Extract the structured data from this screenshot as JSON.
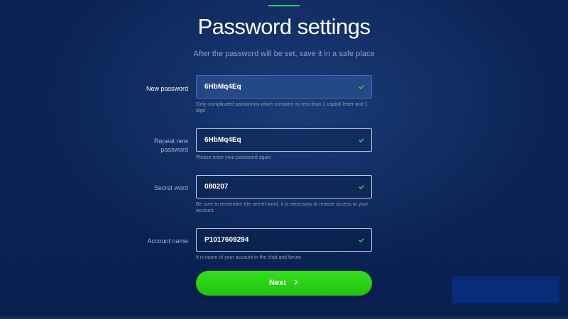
{
  "page": {
    "title": "Password settings",
    "subtitle": "After the password will be set, save it in a safe place"
  },
  "colors": {
    "accent": "#2fd15a",
    "button": "#2bd115",
    "background": "#0b2456",
    "check": "#2fd15a"
  },
  "fields": [
    {
      "label": "New password",
      "value": "6HbMq4Eq",
      "hint": "Only complicated passwords which contains no less than 1 capital letter and 1 digit",
      "valid_icon": "check-icon",
      "focused": true
    },
    {
      "label_line1": "Repeat new",
      "label_line2": "password",
      "value": "6HbMq4Eq",
      "hint": "Please enter your password again",
      "valid_icon": "check-icon"
    },
    {
      "label": "Secret word",
      "value": "080207",
      "hint": "Be sure to remember the secret word, it is necessary to restore access to your account",
      "valid_icon": "check-icon"
    },
    {
      "label": "Account name",
      "value": "P1017609294",
      "hint": "It is name of your account in the chat and forum",
      "valid_icon": "check-icon"
    }
  ],
  "next_button": {
    "label": "Next",
    "icon": "chevron-right-icon"
  }
}
